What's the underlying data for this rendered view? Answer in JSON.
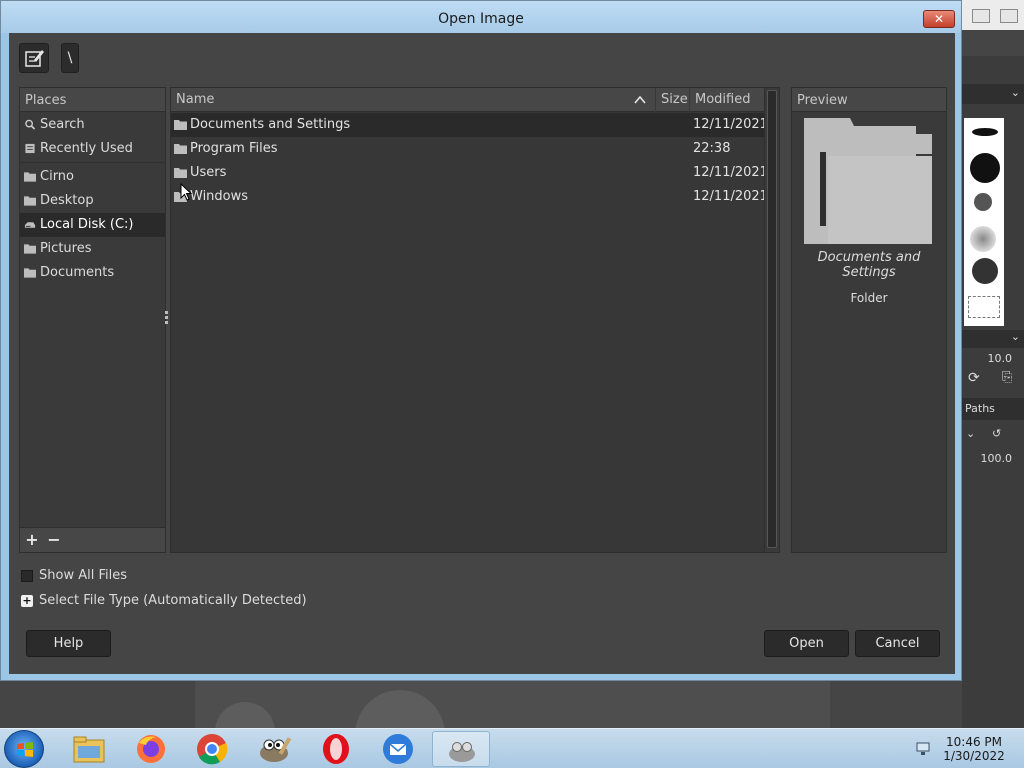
{
  "dialog": {
    "title": "Open Image",
    "close_label": "✕",
    "path_segment": "\\"
  },
  "places": {
    "header": "Places",
    "items": [
      {
        "label": "Search",
        "icon": "search-icon"
      },
      {
        "label": "Recently Used",
        "icon": "recent-icon"
      },
      {
        "label": "Cirno",
        "icon": "folder-icon"
      },
      {
        "label": "Desktop",
        "icon": "folder-icon"
      },
      {
        "label": "Local Disk (C:)",
        "icon": "drive-icon",
        "selected": true
      },
      {
        "label": "Pictures",
        "icon": "folder-icon"
      },
      {
        "label": "Documents",
        "icon": "folder-icon"
      }
    ],
    "add_label": "+",
    "remove_label": "−"
  },
  "files": {
    "columns": {
      "name": "Name",
      "size": "Size",
      "modified": "Modified"
    },
    "rows": [
      {
        "name": "Documents and Settings",
        "size": "",
        "modified": "12/11/2021",
        "selected": true
      },
      {
        "name": "Program Files",
        "size": "",
        "modified": "22:38"
      },
      {
        "name": "Users",
        "size": "",
        "modified": "12/11/2021"
      },
      {
        "name": "Windows",
        "size": "",
        "modified": "12/11/2021"
      }
    ]
  },
  "preview": {
    "header": "Preview",
    "name": "Documents and Settings",
    "kind": "Folder"
  },
  "options": {
    "show_all_files": "Show All Files",
    "show_all_checked": false,
    "select_file_type": "Select File Type (Automatically Detected)"
  },
  "buttons": {
    "help": "Help",
    "open": "Open",
    "cancel": "Cancel"
  },
  "background_app": {
    "brush_size": "10.0",
    "paths_tab": "Paths",
    "opacity": "100.0"
  },
  "taskbar": {
    "time": "10:46 PM",
    "date": "1/30/2022",
    "apps": [
      "file-explorer-icon",
      "firefox-icon",
      "chrome-icon",
      "gimp-icon",
      "opera-icon",
      "thunderbird-icon",
      "gimp-window-icon"
    ]
  },
  "colors": {
    "dialog_bg": "#454545",
    "selection": "#2a2a2a",
    "title_bar": "#a7cbe8",
    "close_button": "#c2402b"
  }
}
